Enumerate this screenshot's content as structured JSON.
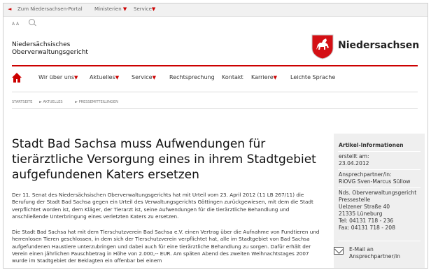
{
  "topbar": {
    "portal_link": "Zum Niedersachsen-Portal",
    "ministries": "Ministerien",
    "service": "Service"
  },
  "tools": {
    "font_size_label": "A A"
  },
  "site": {
    "name_line1": "Niedersächsisches",
    "name_line2": "Oberverwaltungsgericht",
    "logo_text": "Niedersachsen"
  },
  "nav": {
    "items": [
      {
        "label": "Wir über uns",
        "has_arrow": true
      },
      {
        "label": "Aktuelles",
        "has_arrow": true
      },
      {
        "label": "Service",
        "has_arrow": true
      },
      {
        "label": "Rechtsprechung",
        "has_arrow": false
      },
      {
        "label": "Kontakt",
        "has_arrow": false
      },
      {
        "label": "Karriere",
        "has_arrow": true
      },
      {
        "label": "Leichte Sprache",
        "has_arrow": false
      }
    ]
  },
  "breadcrumb": [
    "STARTSEITE",
    "AKTUELLES",
    "PRESSEMITTEILUNGEN"
  ],
  "article": {
    "title": "Stadt Bad Sachsa muss Aufwendungen für tierärztliche Versorgung eines in ihrem Stadtgebiet aufgefundenen Katers ersetzen",
    "p1": "Der 11. Senat des Niedersächsischen Oberverwaltungsgerichts hat mit Urteil vom 23. April 2012 (11 LB 267/11) die Berufung der Stadt Bad Sachsa gegen ein Urteil des Verwaltungsgerichts Göttingen zurückgewiesen, mit dem die Stadt verpflichtet worden ist, dem Kläger, der Tierarzt ist, seine Aufwendungen für die tierärztliche Behandlung und anschließende Unterbringung eines verletzten Katers zu ersetzen.",
    "p2": "Die Stadt Bad Sachsa hat mit dem Tierschutzverein Bad Sachsa e.V. einen Vertrag über die Aufnahme von Fundtieren und herrenlosen Tieren geschlossen, in dem sich der Tierschutzverein verpflichtet hat, alle im Stadtgebiet von Bad Sachsa aufgefundenen Haustiere unterzubringen und dabei auch für eine tierärztliche Behandlung zu sorgen. Dafür erhält der Verein einen jährlichen Pauschbetrag in Höhe von 2.000,-- EUR. Am späten Abend des zweiten Weihnachtstages 2007 wurde im Stadtgebiet der Beklagten ein offenbar bei einem"
  },
  "sidebar": {
    "title": "Artikel-Informationen",
    "created_label": "erstellt am:",
    "created_date": "23.04.2012",
    "contact_label": "Ansprechpartner/in:",
    "contact_name": "RiOVG Sven-Marcus Süllow",
    "org": "Nds. Oberverwaltungsgericht",
    "dept": "Pressestelle",
    "street": "Uelzener Straße 40",
    "city": "21335 Lüneburg",
    "tel": "Tel: 04131 718 - 236",
    "fax": "Fax: 04131 718 - 208",
    "email_line1": "E-Mail an",
    "email_line2": "Ansprechpartner/in"
  },
  "colors": {
    "accent": "#cc0000"
  }
}
